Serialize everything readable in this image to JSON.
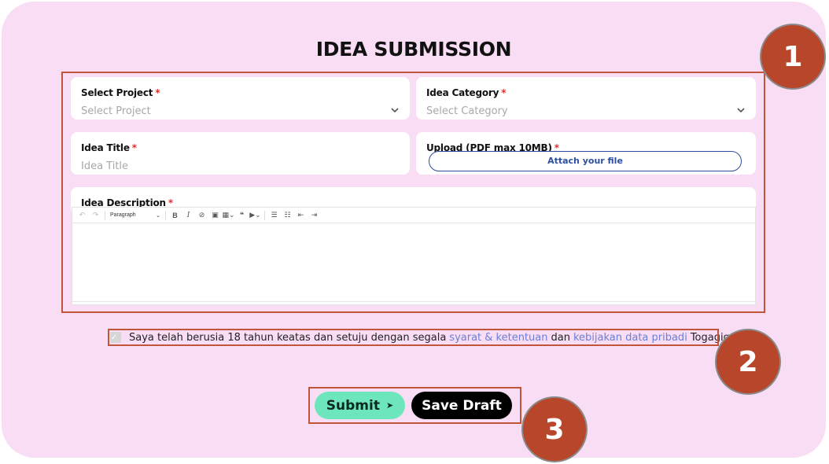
{
  "page": {
    "title": "IDEA SUBMISSION",
    "colors": {
      "background": "#f8ddf4",
      "annotation": "#b8462a",
      "submit": "#6ee6bd",
      "link": "#6a7fd6"
    }
  },
  "annotations": [
    "1",
    "2",
    "3"
  ],
  "form": {
    "project": {
      "label": "Select Project",
      "required": "*",
      "placeholder": "Select Project",
      "icon": "chevron-down-icon"
    },
    "category": {
      "label": "Idea Category",
      "required": "*",
      "placeholder": "Select Category",
      "icon": "chevron-down-icon"
    },
    "title": {
      "label": "Idea Title",
      "required": "*",
      "placeholder": "Idea Title"
    },
    "upload": {
      "label": "Upload (PDF max 10MB)",
      "required": "*",
      "button": "Attach your file"
    },
    "description": {
      "label": "Idea Description",
      "required": "*",
      "toolbar": {
        "block_format": "Paragraph",
        "icons": [
          "undo-icon",
          "redo-icon",
          "bold-icon",
          "italic-icon",
          "link-icon",
          "image-icon",
          "table-icon",
          "quote-icon",
          "media-icon",
          "bulleted-list-icon",
          "numbered-list-icon",
          "outdent-icon",
          "indent-icon"
        ]
      }
    }
  },
  "consent": {
    "text_before": "Saya telah berusia 18 tahun keatas dan setuju dengan segala",
    "link_terms": "syarat & ketentuan",
    "text_middle": "dan",
    "link_privacy": "kebijakan data pribadi",
    "text_after": "Togagig"
  },
  "actions": {
    "submit": "Submit",
    "save_draft": "Save Draft"
  }
}
